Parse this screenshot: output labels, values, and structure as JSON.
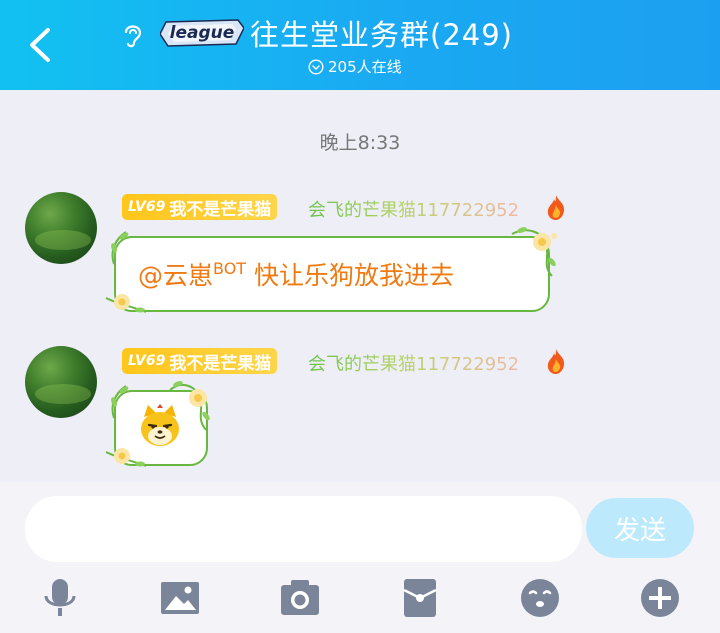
{
  "header": {
    "title": "往生堂业务群(249)",
    "online_text": "205人在线",
    "badge_text": "league"
  },
  "chat": {
    "time_label": "晚上8:33",
    "messages": [
      {
        "level": "LV69",
        "nickname": "我不是芒果猫",
        "sender": "会飞的芒果猫117722952",
        "text_mention": "@云崽",
        "text_sup": "BOT",
        "text_body": " 快让乐狗放我进去"
      },
      {
        "level": "LV69",
        "nickname": "我不是芒果猫",
        "sender": "会飞的芒果猫117722952",
        "sticker": "cat-face-sticker"
      }
    ]
  },
  "input": {
    "value": "",
    "send_label": "发送"
  },
  "toolbar": {
    "icons": [
      "microphone-icon",
      "image-icon",
      "camera-icon",
      "red-packet-icon",
      "emoji-icon",
      "plus-icon"
    ]
  },
  "colors": {
    "header_start": "#12c1f1",
    "header_end": "#1c9ff0",
    "bubble_border": "#67b740",
    "message_text": "#f07a12",
    "level_badge": "#ffc61a",
    "send_button": "#bce9fb",
    "toolbar_icon": "#7a8599"
  }
}
